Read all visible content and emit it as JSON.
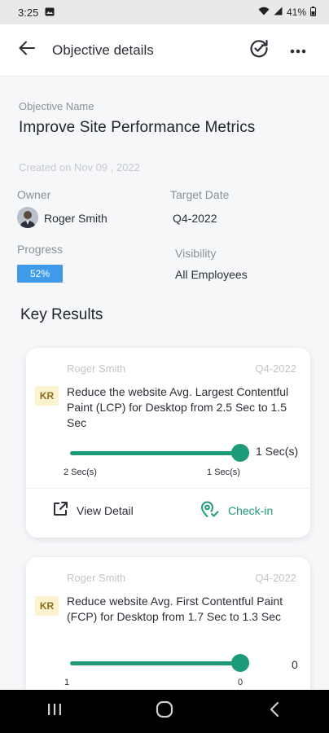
{
  "status_bar": {
    "time": "3:25",
    "battery": "41%"
  },
  "header": {
    "title": "Objective details",
    "back_icon": "arrow-left-icon",
    "refresh_icon": "refresh-check-icon",
    "more_icon": "more-horizontal-icon"
  },
  "objective": {
    "name_label": "Objective Name",
    "name": "Improve Site Performance Metrics",
    "created": "Created on Nov 09 , 2022",
    "owner_label": "Owner",
    "owner_name": "Roger Smith",
    "target_label": "Target Date",
    "target_value": "Q4-2022",
    "progress_label": "Progress",
    "progress_value": "52%",
    "progress_color": "#3d9be9",
    "visibility_label": "Visibility",
    "visibility_value": "All Employees"
  },
  "key_results_title": "Key Results",
  "key_results": [
    {
      "owner": "Roger Smith",
      "period": "Q4-2022",
      "badge": "KR",
      "title": "Reduce the website Avg. Largest Contentful Paint (LCP) for Desktop from 2.5 Sec to 1.5 Sec",
      "current": "1 Sec(s)",
      "start_label": "2 Sec(s)",
      "end_label": "1 Sec(s)",
      "view_detail": "View Detail",
      "check_in": "Check-in"
    },
    {
      "owner": "Roger Smith",
      "period": "Q4-2022",
      "badge": "KR",
      "title": "Reduce website Avg. First Contentful Paint (FCP) for Desktop from 1.7 Sec to 1.3 Sec",
      "current": "0",
      "start_label": "1",
      "end_label": "0"
    }
  ],
  "colors": {
    "accent": "#1d9b79",
    "badge_bg": "#fbf2cf"
  }
}
